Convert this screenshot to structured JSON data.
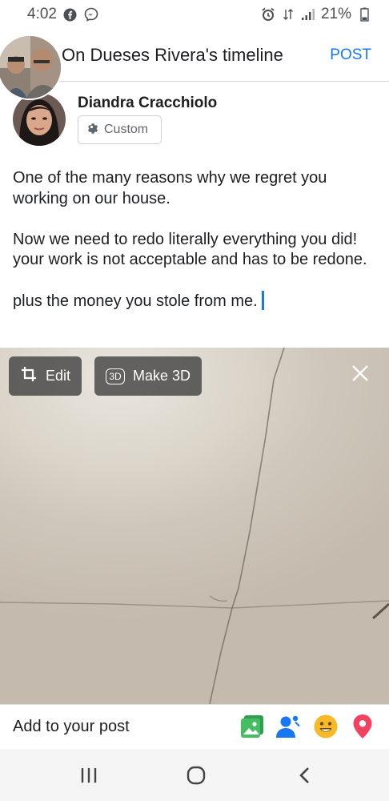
{
  "status_bar": {
    "time": "4:02",
    "battery": "21%",
    "icons": [
      "facebook-icon",
      "messenger-icon",
      "alarm-icon",
      "data-arrows-icon",
      "signal-icon",
      "battery-icon"
    ]
  },
  "header": {
    "title": "On Dueses Rivera's timeline",
    "post_label": "POST"
  },
  "author": {
    "name": "Diandra Cracchiolo",
    "privacy_label": "Custom"
  },
  "post": {
    "paragraph_1": "One of the many reasons why we regret you working on our house.",
    "paragraph_2": "Now we need to redo literally everything you did! your work is not acceptable and has to be redone.",
    "paragraph_3": "plus the money you stole from me."
  },
  "photo_controls": {
    "edit_label": "Edit",
    "make3d_label": "Make 3D",
    "make3d_badge": "3D"
  },
  "add_bar": {
    "label": "Add to your post",
    "icons": [
      "photo-icon",
      "tag-people-icon",
      "feeling-icon",
      "location-icon"
    ]
  },
  "colors": {
    "accent": "#1877f2",
    "photo_green": "#45bd62",
    "emoji_yellow": "#f7b928",
    "location_red": "#f3425f"
  }
}
